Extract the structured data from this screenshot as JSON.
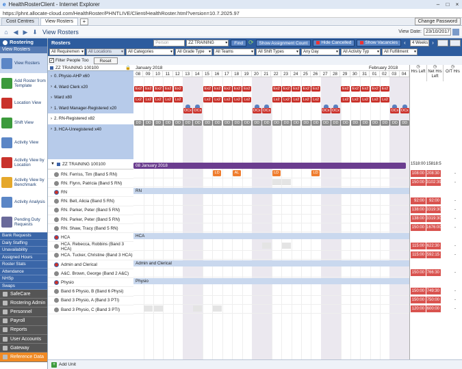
{
  "window": {
    "title": "HealthRosterClient - Internet Explorer"
  },
  "browser": {
    "url": "https://phnt.allocate-cloud.com/HealthRoster/PHNTLIVE/Client/HealthRoster.html?version=10.7.2025.97"
  },
  "tabs": [
    {
      "label": "Cost Centres"
    },
    {
      "label": "View Rosters"
    }
  ],
  "change_password": "Change Password",
  "toolbar": {
    "page_title": "View Rosters",
    "view_date_label": "View Date:",
    "view_date": "23/10/2017"
  },
  "sidebar": {
    "header": "Rostering",
    "subheader": "View Rosters",
    "items": [
      {
        "label": "View Rosters",
        "color": "#5b86c6"
      },
      {
        "label": "Add Roster from Template",
        "color": "#3c9a3c"
      },
      {
        "label": "Location View",
        "color": "#c9322b"
      },
      {
        "label": "Shift View",
        "color": "#3c9a3c"
      },
      {
        "label": "Activity View",
        "color": "#5b86c6"
      },
      {
        "label": "Activity View by Location",
        "color": "#c9322b"
      },
      {
        "label": "Activity View by Benchmark",
        "color": "#e5a82b"
      },
      {
        "label": "Activity Analysis",
        "color": "#5b86c6"
      },
      {
        "label": "Pending Duty Requests",
        "color": "#6a6a9a"
      }
    ],
    "nav": [
      "Bank Requests",
      "Daily Staffing",
      "Unavailability",
      "Assigned Hours",
      "Roster Stats",
      "Attendance",
      "NHSp",
      "Swaps"
    ],
    "modules": [
      "SafeCare",
      "Rostering Admin",
      "Personnel",
      "Payroll",
      "Reports",
      "User Accounts",
      "Gateway",
      "Reference Data"
    ]
  },
  "rosters_header": {
    "label": "Rosters",
    "person_search_placeholder": "Person Search...",
    "unit_select": "ZZ TRAINING 100100",
    "find": "Find",
    "show_assignment_count": "Show Assignment Count",
    "hide_cancelled": "Hide Cancelled",
    "show_vacancies": "Show Vacancies",
    "weeks": "4 Weeks"
  },
  "filters": [
    "All Requiremen",
    "All Locations",
    "All Categories",
    "All Grade Type",
    "All Teams",
    "All Shift Types",
    "Any Day",
    "All Activity Typ",
    "All Fulfillment"
  ],
  "filter_people": {
    "label": "Filter People Too",
    "reset": "Reset"
  },
  "unit": {
    "name": "ZZ TRAINING 100100"
  },
  "requirements": [
    {
      "label": "0. Physio-AHP x60"
    },
    {
      "label": "4. Ward Clerk x20"
    },
    {
      "label": "Ward x80"
    },
    {
      "label": "1. Ward Manager-Registered x20"
    },
    {
      "label": "2. RN-Registered x82"
    },
    {
      "label": "3. HCA-Unregistered x40"
    }
  ],
  "calendar": {
    "month1": "January 2018",
    "month2": "February 2018",
    "days": [
      "08",
      "09",
      "10",
      "11",
      "12",
      "13",
      "14",
      "15",
      "16",
      "17",
      "18",
      "19",
      "20",
      "21",
      "22",
      "23",
      "24",
      "25",
      "26",
      "27",
      "28",
      "29",
      "30",
      "31",
      "01",
      "02",
      "03",
      "04"
    ]
  },
  "banner": "08 January 2018",
  "people_unit": "ZZ TRAINING 100100",
  "people": [
    {
      "name": "RN. Ferriss, Tim (Band 5 RN)",
      "hl": "108:00",
      "nhl": "208:30",
      "type": "person"
    },
    {
      "name": "RN. Flynn, Patricia (Band 5 RN)",
      "hl": "150:00",
      "nhl": "3102:39",
      "type": "person"
    },
    {
      "name": "RN",
      "type": "group"
    },
    {
      "name": "RN. Bell, Alicia (Band 5 RN)",
      "hl": "92:00",
      "nhl": "92:00",
      "type": "person"
    },
    {
      "name": "RN. Parker, Peter (Band 5 RN)",
      "hl": "138:00",
      "nhl": "3319:30",
      "type": "person"
    },
    {
      "name": "RN. Parker, Peter (Band 5 RN)",
      "hl": "138:00",
      "nhl": "3319:30",
      "type": "person"
    },
    {
      "name": "RN. Shaw, Tracy (Band 5 RN)",
      "hl": "150:00",
      "nhl": "1676:00",
      "type": "person"
    },
    {
      "name": "HCA",
      "type": "group"
    },
    {
      "name": "HCA. Rebecca, Robbins (Band 3 HCA)",
      "hl": "115:00",
      "nhl": "622:30",
      "type": "person"
    },
    {
      "name": "HCA. Tucker, Christine (Band 3 HCA)",
      "hl": "115:00",
      "nhl": "592:15",
      "type": "person"
    },
    {
      "name": "Admin and Clerical",
      "type": "group"
    },
    {
      "name": "A&C. Brown, George (Band 2 A&C)",
      "hl": "150:00",
      "nhl": "766:30",
      "type": "person"
    },
    {
      "name": "Physio",
      "type": "group"
    },
    {
      "name": "Band 6 Physio, B (Band 6 Physi)",
      "hl": "150:00",
      "nhl": "749:30",
      "type": "person"
    },
    {
      "name": "Band 3 Physio, A (Band 3 PTI)",
      "hl": "150:00",
      "nhl": "750:00",
      "type": "person"
    },
    {
      "name": "Band 3 Physio, C (Band 3 PTI)",
      "hl": "120:00",
      "nhl": "600:00",
      "type": "person"
    }
  ],
  "hours_cols": {
    "hl": "Hrs Left",
    "nhl": "Net Hrs Left",
    "ot": "O/T Hrs"
  },
  "unit_totals": {
    "hl": "1518:00",
    "nhl": "15818:5"
  },
  "shift_codes": {
    "ex": "Ex2",
    "lx": "Lx2",
    "occ": "OCx",
    "dd": "DD",
    "ld": "LD",
    "al": "AL"
  },
  "add_unit": "Add Unit"
}
